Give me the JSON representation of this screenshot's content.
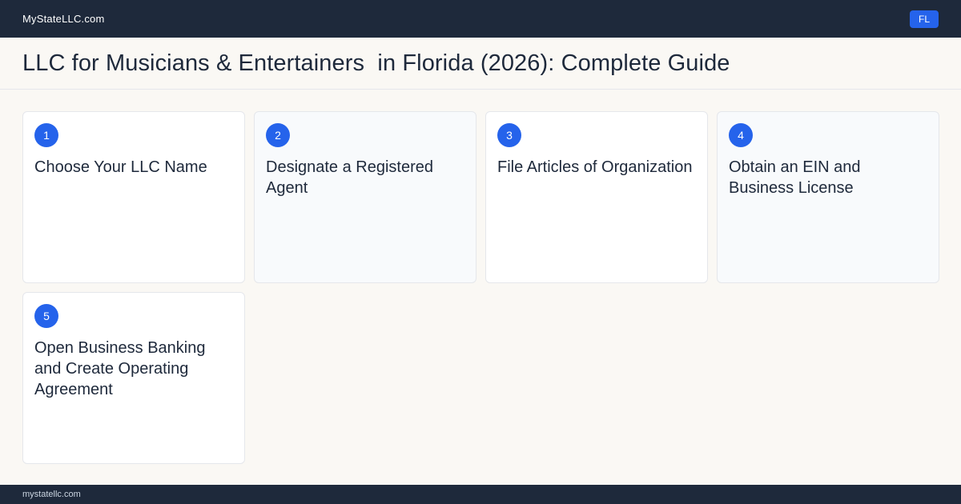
{
  "header": {
    "brand": "MyStateLLC.com",
    "state_badge": "FL"
  },
  "page": {
    "title": "LLC for Musicians & Entertainers  in Florida (2026): Complete Guide"
  },
  "steps": [
    {
      "number": "1",
      "title": "Choose Your LLC Name"
    },
    {
      "number": "2",
      "title": "Designate a Registered Agent"
    },
    {
      "number": "3",
      "title": "File Articles of Organization"
    },
    {
      "number": "4",
      "title": "Obtain an EIN and Business License"
    },
    {
      "number": "5",
      "title": "Open Business Banking and Create Operating Agreement"
    }
  ],
  "footer": {
    "domain": "mystatellc.com"
  },
  "colors": {
    "navy": "#1e293b",
    "accent": "#2563eb",
    "background": "#faf8f4"
  }
}
